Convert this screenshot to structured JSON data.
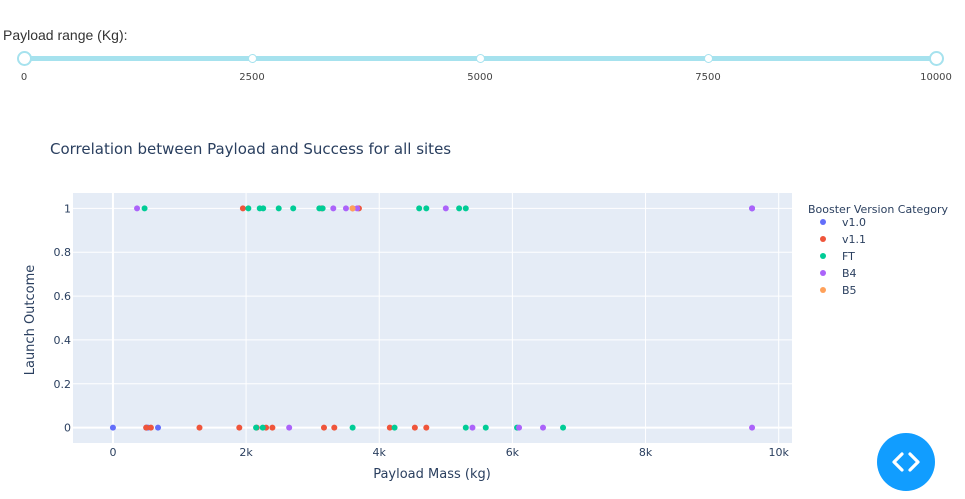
{
  "slider": {
    "label": "Payload range (Kg):",
    "min": 0,
    "max": 10000,
    "selected_low": 0,
    "selected_high": 10000,
    "marks": [
      "0",
      "2500",
      "5000",
      "7500",
      "10000"
    ],
    "track_color": "#a6e2ee"
  },
  "toggle_button": {
    "icon": "code-brackets-icon",
    "color": "#119dff"
  },
  "chart_data": {
    "type": "scatter",
    "title": "Correlation between Payload and Success for all sites",
    "xlabel": "Payload Mass (kg)",
    "ylabel": "Launch Outcome",
    "xlim": [
      -600,
      10200
    ],
    "ylim": [
      -0.07,
      1.07
    ],
    "xticks": [
      0,
      2000,
      4000,
      6000,
      8000,
      10000
    ],
    "xtick_labels": [
      "0",
      "2k",
      "4k",
      "6k",
      "8k",
      "10k"
    ],
    "yticks": [
      0,
      0.2,
      0.4,
      0.6,
      0.8,
      1
    ],
    "ytick_labels": [
      "0",
      "0.2",
      "0.4",
      "0.6",
      "0.8",
      "1"
    ],
    "grid": true,
    "plot_background": "#e5ecf6",
    "legend_title": "Booster Version Category",
    "legend_position": "right",
    "series": [
      {
        "name": "v1.0",
        "color": "#636efa",
        "points": [
          [
            0,
            0
          ],
          [
            525,
            0
          ],
          [
            677,
            0
          ],
          [
            500,
            0
          ],
          [
            9600,
            1
          ]
        ]
      },
      {
        "name": "v1.1",
        "color": "#ef553b",
        "points": [
          [
            500,
            0
          ],
          [
            570,
            0
          ],
          [
            1300,
            0
          ],
          [
            1898,
            0
          ],
          [
            2160,
            0
          ],
          [
            2300,
            0
          ],
          [
            2395,
            0
          ],
          [
            3170,
            0
          ],
          [
            3325,
            0
          ],
          [
            4159,
            0
          ],
          [
            4535,
            0
          ],
          [
            4707,
            0
          ],
          [
            1952,
            1
          ],
          [
            3136,
            1
          ],
          [
            3600,
            1
          ],
          [
            3695,
            1
          ]
        ]
      },
      {
        "name": "FT",
        "color": "#00cc96",
        "points": [
          [
            475,
            1
          ],
          [
            2034,
            1
          ],
          [
            2205,
            1
          ],
          [
            2257,
            1
          ],
          [
            2490,
            1
          ],
          [
            2708,
            1
          ],
          [
            3100,
            1
          ],
          [
            3150,
            1
          ],
          [
            4600,
            1
          ],
          [
            4707,
            1
          ],
          [
            5200,
            1
          ],
          [
            5300,
            1
          ],
          [
            2150,
            0
          ],
          [
            2250,
            0
          ],
          [
            3600,
            0
          ],
          [
            4230,
            0
          ],
          [
            5300,
            0
          ],
          [
            5600,
            0
          ],
          [
            6070,
            0
          ],
          [
            6761,
            0
          ]
        ]
      },
      {
        "name": "B4",
        "color": "#ab63fa",
        "points": [
          [
            362,
            1
          ],
          [
            3310,
            1
          ],
          [
            3500,
            1
          ],
          [
            3669,
            1
          ],
          [
            5000,
            1
          ],
          [
            9600,
            1
          ],
          [
            2647,
            0
          ],
          [
            5400,
            0
          ],
          [
            6100,
            0
          ],
          [
            6460,
            0
          ],
          [
            9600,
            0
          ]
        ]
      },
      {
        "name": "B5",
        "color": "#ffa15a",
        "points": [
          [
            3600,
            1
          ]
        ]
      }
    ]
  }
}
